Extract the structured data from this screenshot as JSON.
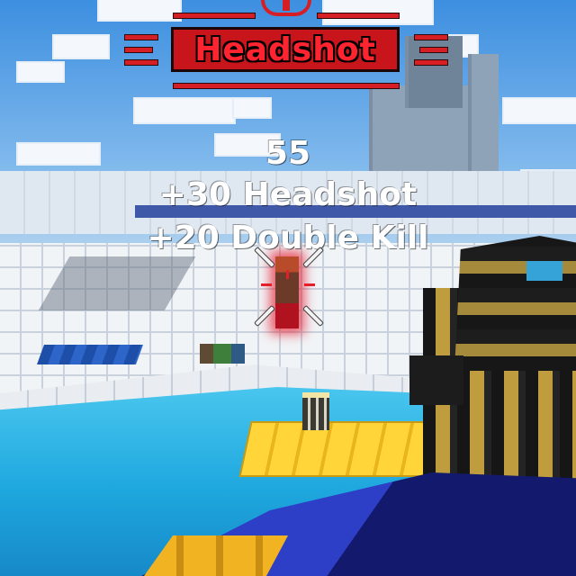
{
  "hud": {
    "banner_text": "Headshot",
    "score_total": "55",
    "score_lines": [
      "+30 Headshot",
      "+20 Double Kill"
    ]
  },
  "icons": {
    "banner_emblem": "skull-icon",
    "reticle": "crosshair-icon"
  },
  "colors": {
    "banner_red": "#d61f25",
    "score_text": "#ffffff",
    "hit_highlight": "#e6142a"
  }
}
